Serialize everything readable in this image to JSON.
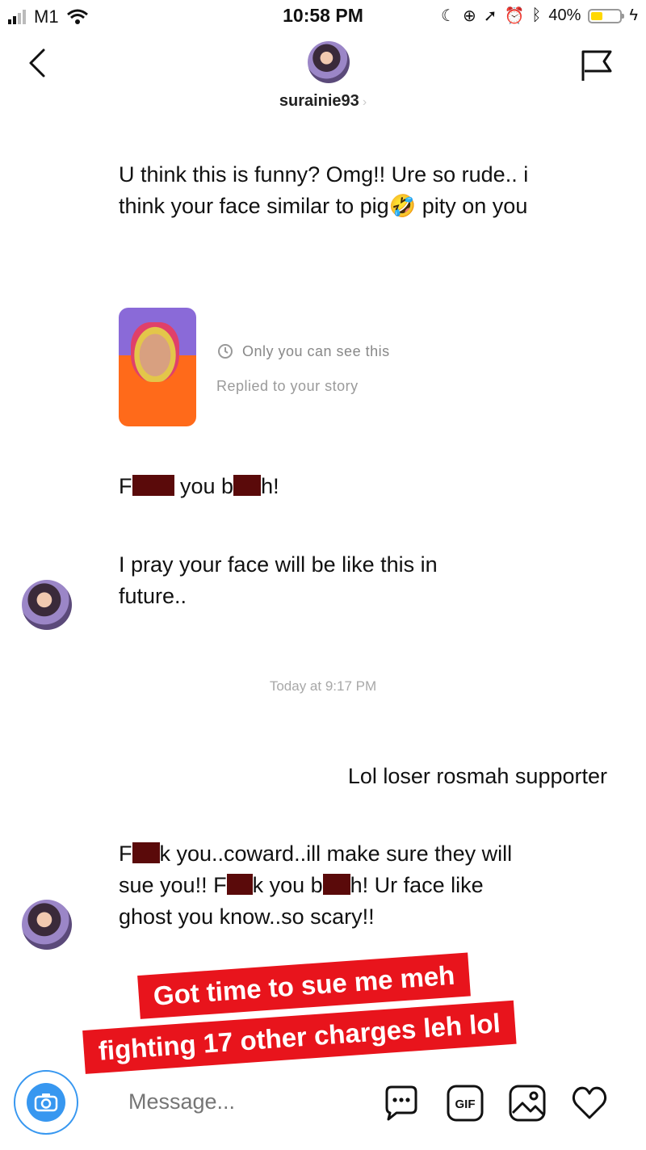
{
  "status_bar": {
    "carrier": "M1",
    "time": "10:58 PM",
    "battery_percent": "40%",
    "battery_level": 0.4
  },
  "header": {
    "username": "surainie93",
    "username_chevron": "›"
  },
  "messages": [
    {
      "text": "U think this is funny? Omg!! Ure so rude.. i think your face similar to pig🤣 pity on you"
    },
    {
      "story_reply": {
        "only_you": "Only you can see this",
        "replied": "Replied to your story"
      }
    },
    {
      "parts": [
        "F",
        "",
        " you b",
        "",
        "h!"
      ]
    },
    {
      "text": "I pray your face will be like this in future.."
    },
    {
      "timestamp": "Today at 9:17 PM"
    },
    {
      "sent_text": "Lol loser rosmah supporter"
    },
    {
      "parts": [
        "F",
        "",
        "k you..coward..ill make sure they will sue you!! F",
        "",
        "k you b",
        "",
        "h! Ur face like ghost you know..so scary!!"
      ]
    }
  ],
  "overlay_caption": {
    "line1": "Got time to sue me meh",
    "line2": "fighting 17 other charges leh lol"
  },
  "composer": {
    "placeholder": "Message..."
  },
  "icons": [
    "back-arrow-icon",
    "flag-icon",
    "camera-icon",
    "chat-bubble-icon",
    "gif-icon",
    "image-icon",
    "heart-icon"
  ],
  "colors": {
    "accent": "#3797f0",
    "caption": "#e8141c",
    "redaction": "#5a0a0a"
  }
}
